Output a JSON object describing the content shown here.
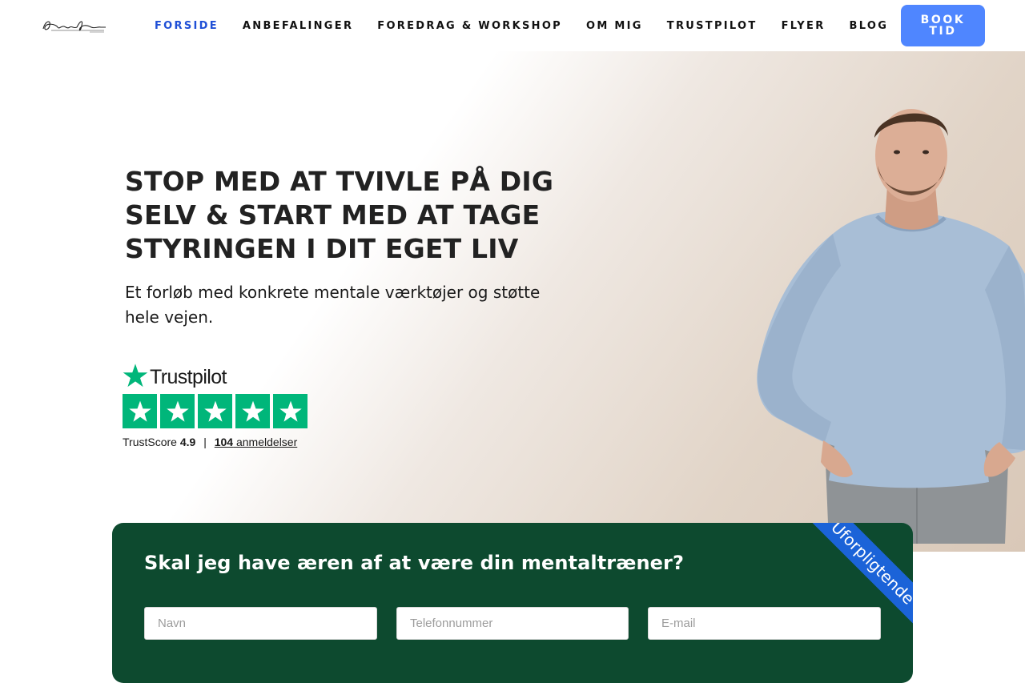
{
  "header": {
    "logo_alt": "Andreas Klarlund signature logo",
    "nav": [
      {
        "label": "FORSIDE",
        "active": true
      },
      {
        "label": "ANBEFALINGER",
        "active": false
      },
      {
        "label": "FOREDRAG & WORKSHOP",
        "active": false
      },
      {
        "label": "OM MIG",
        "active": false
      },
      {
        "label": "TRUSTPILOT",
        "active": false
      },
      {
        "label": "FLYER",
        "active": false
      },
      {
        "label": "BLOG",
        "active": false
      }
    ],
    "book_button": "BOOK TID"
  },
  "hero": {
    "title": "STOP MED AT TVIVLE PÅ DIG SELV & START MED AT TAGE STYRINGEN I DIT EGET LIV",
    "subtitle": "Et forløb med konkrete mentale værktøjer og støtte hele vejen."
  },
  "trustpilot": {
    "brand": "Trustpilot",
    "stars": 5,
    "score_label": "TrustScore",
    "score": "4.9",
    "separator": "|",
    "review_count": "104",
    "reviews_label": "anmeldelser"
  },
  "form": {
    "title": "Skal jeg have æren af at være din mentaltræner?",
    "ribbon": "Uforpligtende",
    "fields": {
      "name_placeholder": "Navn",
      "phone_placeholder": "Telefonnummer",
      "email_placeholder": "E-mail"
    }
  },
  "colors": {
    "nav_active": "#1f4fd6",
    "book_button": "#4f86ff",
    "card_bg": "#0d4a2f",
    "ribbon": "#1b63d8",
    "trustpilot_green": "#00b67a"
  }
}
